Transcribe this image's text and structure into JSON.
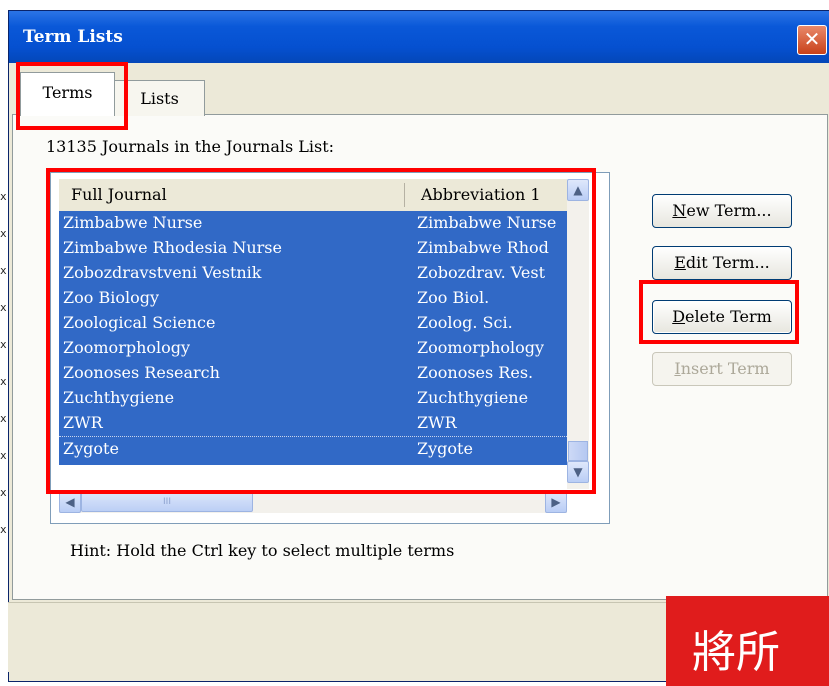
{
  "window": {
    "title": "Term Lists",
    "close_glyph": "✕"
  },
  "tabs": [
    {
      "label": "Terms",
      "selected": true
    },
    {
      "label": "Lists",
      "selected": false
    }
  ],
  "journals_count_text": "13135 Journals in the Journals List:",
  "list": {
    "columns": [
      "Full Journal",
      "Abbreviation 1"
    ],
    "rows": [
      {
        "full": "Zimbabwe Nurse",
        "abbr": "Zimbabwe Nurse"
      },
      {
        "full": "Zimbabwe Rhodesia Nurse",
        "abbr": "Zimbabwe Rhod"
      },
      {
        "full": "Zobozdravstveni Vestnik",
        "abbr": "Zobozdrav. Vest"
      },
      {
        "full": "Zoo Biology",
        "abbr": "Zoo Biol."
      },
      {
        "full": "Zoological Science",
        "abbr": "Zoolog. Sci."
      },
      {
        "full": "Zoomorphology",
        "abbr": "Zoomorphology"
      },
      {
        "full": "Zoonoses Research",
        "abbr": "Zoonoses Res."
      },
      {
        "full": "Zuchthygiene",
        "abbr": "Zuchthygiene"
      },
      {
        "full": "ZWR",
        "abbr": "ZWR"
      },
      {
        "full": "Zygote",
        "abbr": "Zygote"
      }
    ],
    "scroll_up_glyph": "▲",
    "scroll_down_glyph": "▼",
    "scroll_left_glyph": "◀",
    "scroll_right_glyph": "▶",
    "h_thumb_grip": "III"
  },
  "buttons": {
    "new_term": {
      "accel": "N",
      "rest": "ew Term..."
    },
    "edit_term": {
      "accel": "E",
      "rest": "dit Term..."
    },
    "delete_term": {
      "accel": "D",
      "rest": "elete Term"
    },
    "insert_term": {
      "accel": "I",
      "rest": "nsert Term",
      "enabled": false
    }
  },
  "hint": "Hint: Hold the Ctrl key to select multiple terms",
  "callout_text": "將所",
  "left_edge_marks": [
    "x",
    "x",
    "x",
    "x",
    "x",
    "x",
    "x",
    "x",
    "x",
    "x"
  ],
  "colors": {
    "selection": "#3169c6",
    "titlebar": "#0550d0",
    "highlight": "#ff0000",
    "callout": "#e01c1c"
  },
  "icons": {
    "close": "close-icon",
    "scroll_up": "scroll-up-arrow-icon",
    "scroll_down": "scroll-down-arrow-icon",
    "scroll_left": "scroll-left-arrow-icon",
    "scroll_right": "scroll-right-arrow-icon"
  }
}
